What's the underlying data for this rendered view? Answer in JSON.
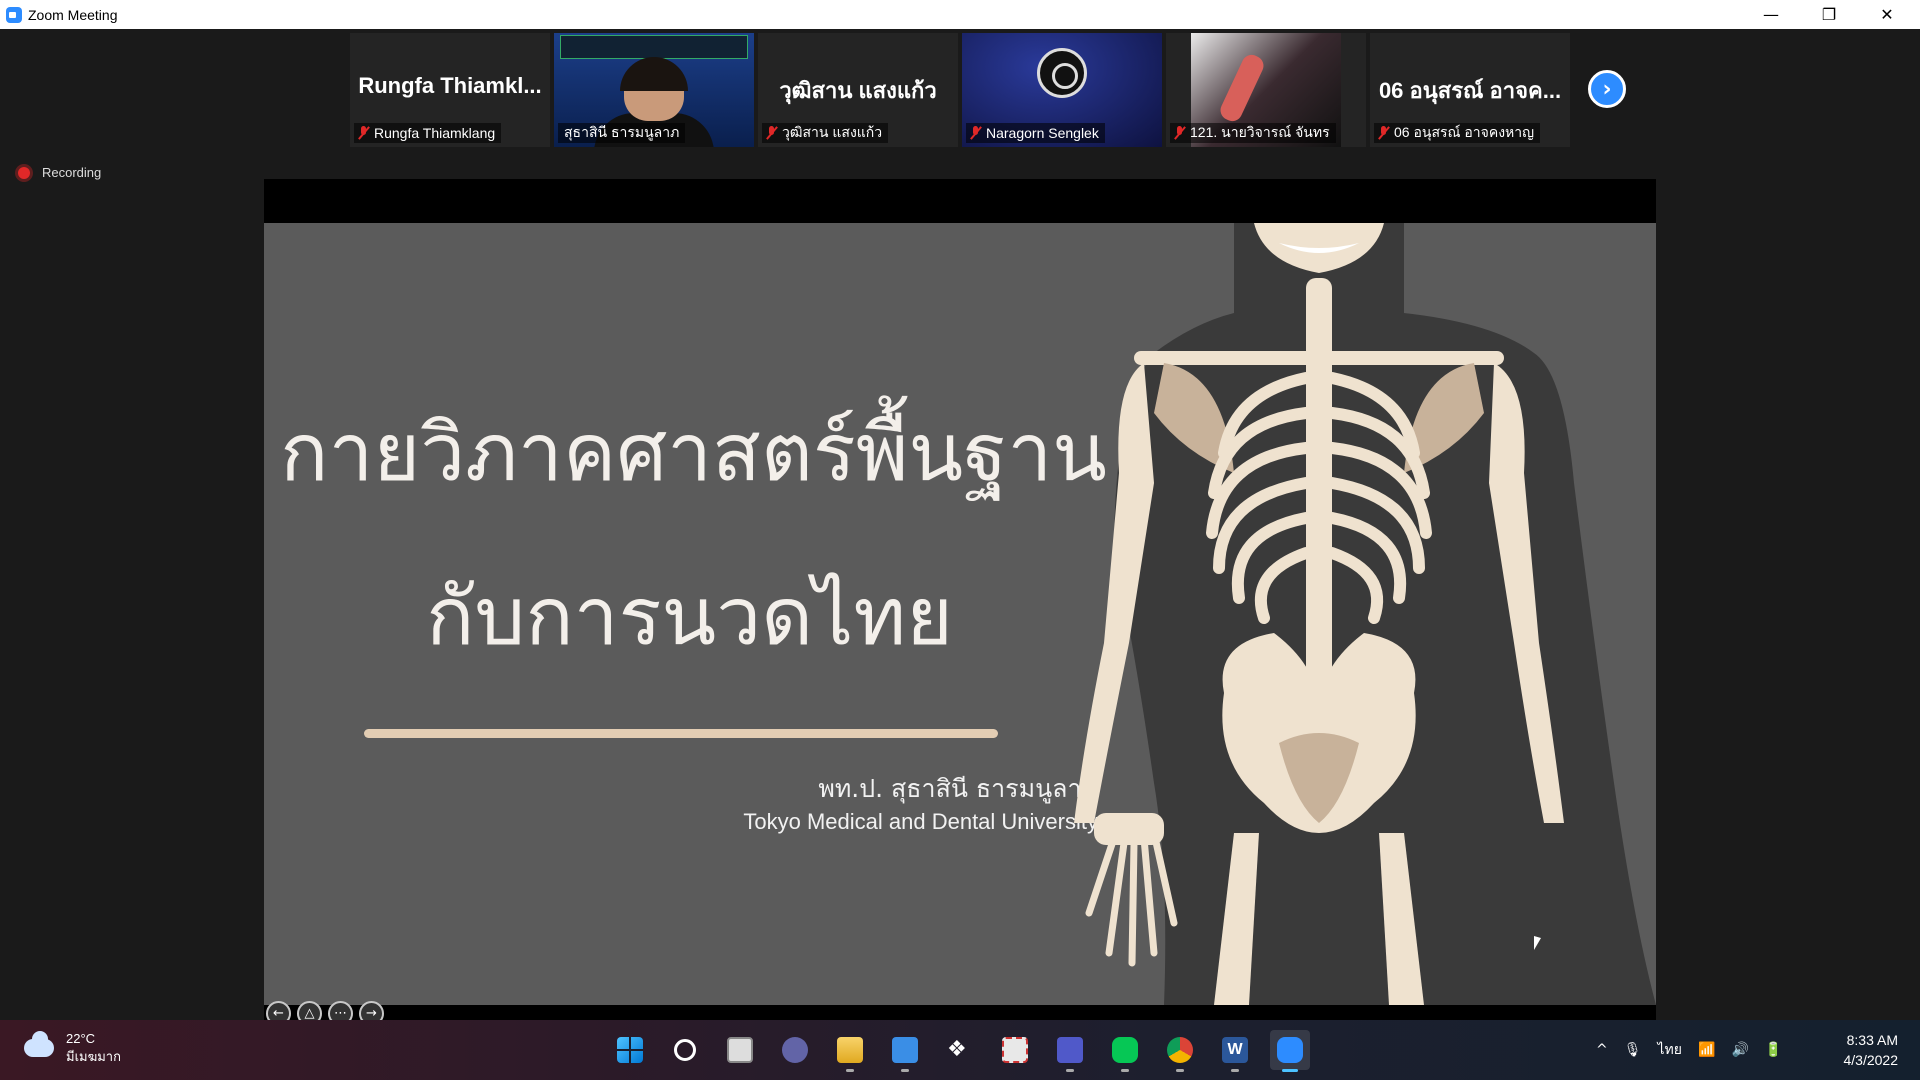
{
  "window": {
    "title": "Zoom Meeting"
  },
  "window_controls": {
    "minimize": "—",
    "maximize": "❐",
    "close": "✕"
  },
  "gallery": {
    "tiles": [
      {
        "big_name": "Rungfa  Thiamkl...",
        "label": "Rungfa Thiamklang",
        "muted": true,
        "video": false
      },
      {
        "big_name": "",
        "label": "สุธาสินี ธารมนูลาภ",
        "muted": false,
        "video": true,
        "active": true
      },
      {
        "big_name": "วุฒิสาน แสงแก้ว",
        "label": "วุฒิสาน แสงแก้ว",
        "muted": true,
        "video": false
      },
      {
        "big_name": "",
        "label": "Naragorn Senglek",
        "muted": true,
        "video": true
      },
      {
        "big_name": "",
        "label": "121. นายวิจารณ์ จันทร",
        "muted": true,
        "video": true
      },
      {
        "big_name": "06 อนุสรณ์  อาจค...",
        "label": "06 อนุสรณ์ อาจคงหาญ",
        "muted": true,
        "video": false
      }
    ],
    "next_page_glyph": "›"
  },
  "recording": {
    "label": "Recording"
  },
  "slide": {
    "title_line1": "กายวิภาคศาสตร์พื้นฐาน",
    "title_line2": "กับการนวดไทย",
    "author": "พท.ป. สุธาสินี ธารมนูลาภ",
    "affiliation": "Tokyo Medical and Dental University"
  },
  "slide_controls": {
    "prev": "←",
    "pen": "△",
    "more": "⋯",
    "next": "→"
  },
  "taskbar": {
    "weather": {
      "temp": "22°C",
      "condition": "มีเมฆมาก"
    },
    "apps": [
      {
        "name": "start",
        "active": false
      },
      {
        "name": "search",
        "active": false
      },
      {
        "name": "task-view",
        "active": false
      },
      {
        "name": "chat",
        "active": false
      },
      {
        "name": "file-explorer",
        "active": false
      },
      {
        "name": "notes",
        "active": false
      },
      {
        "name": "dropbox",
        "active": false
      },
      {
        "name": "snipping-tool",
        "active": false
      },
      {
        "name": "teams",
        "active": false
      },
      {
        "name": "line",
        "active": false
      },
      {
        "name": "chrome",
        "active": false
      },
      {
        "name": "word",
        "active": false
      },
      {
        "name": "zoom",
        "active": true
      }
    ],
    "word_letter": "W",
    "dropbox_glyph": "❖",
    "tray": {
      "chevron": "^",
      "mic": "🎙",
      "lang": "ไทย",
      "wifi": "📶",
      "volume": "🔊",
      "battery": "🔋"
    },
    "clock": {
      "time": "8:33 AM",
      "date": "4/3/2022"
    }
  },
  "colors": {
    "zoom_blue": "#2d8cff",
    "record_red": "#e02828",
    "active_green": "#00d24b",
    "slide_bg": "#5b5b5b",
    "slide_accent": "#e3cdb3"
  }
}
